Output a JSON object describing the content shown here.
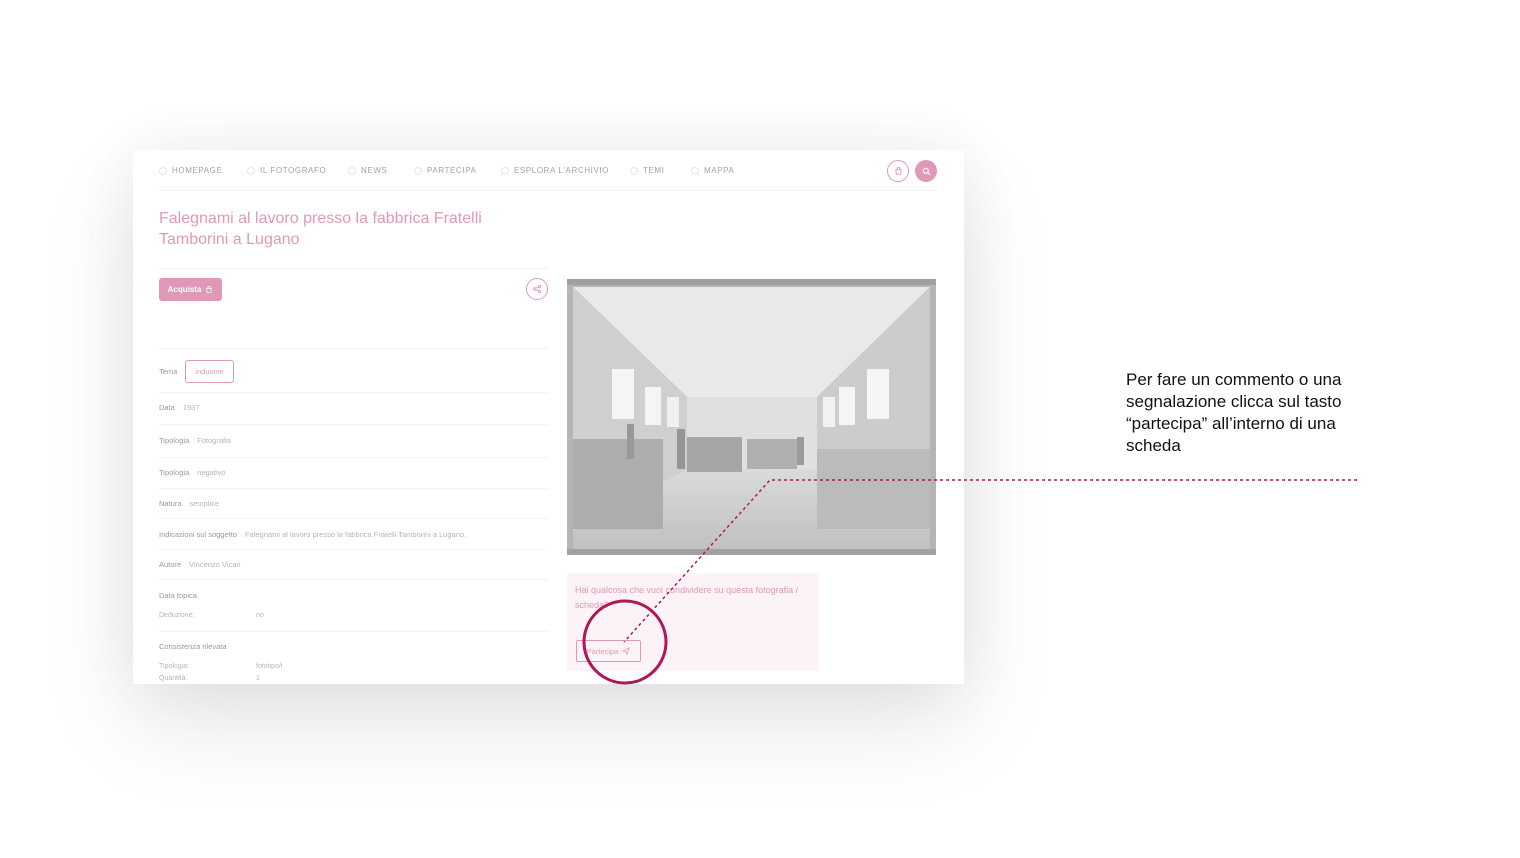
{
  "nav": {
    "items": [
      "HOMEPAGE",
      "IL FOTOGRAFO",
      "NEWS",
      "PARTECIPA",
      "ESPLORA L'ARCHIVIO",
      "TEMI",
      "MAPPA"
    ],
    "cart_icon": "cart-icon",
    "search_icon": "search-icon"
  },
  "record": {
    "title": "Falegnami al lavoro presso la fabbrica Fratelli Tamborini a Lugano",
    "buy_label": "Acquista",
    "share_icon": "share-icon",
    "tema": {
      "label": "Tema",
      "value": "industrie"
    },
    "data": {
      "label": "Data",
      "value": "1937"
    },
    "tipologia1": {
      "label": "Tipologia",
      "value": "Fotografia"
    },
    "tipologia2": {
      "label": "Tipologia",
      "value": "negativo"
    },
    "natura": {
      "label": "Natura",
      "value": "semplice"
    },
    "soggetto": {
      "label": "Indicazioni sul soggetto",
      "value": "Falegnami al lavoro presso la fabbrica Fratelli Tamborini a Lugano."
    },
    "autore": {
      "label": "Autore",
      "value": "Vincenzo Vicari"
    },
    "data_topica": {
      "label": "Data topica",
      "deduzione_label": "Deduzione:",
      "deduzione_value": "no"
    },
    "consistenza": {
      "label": "Consistenza rilevata",
      "tipologia_label": "Tipologia:",
      "tipologia_value": "fototipo/i",
      "quantita_label": "Quantità:",
      "quantita_value": "1"
    }
  },
  "participate": {
    "question": "Hai qualcosa che vuoi condividere su questa fotografia / scheda?",
    "button_label": "Partecipa"
  },
  "annotation": {
    "text": "Per fare un commento o una segnalazione clicca sul tasto “partecipa” all’interno di una scheda"
  },
  "colors": {
    "accent": "#c8457e",
    "callout": "#b0175a"
  }
}
